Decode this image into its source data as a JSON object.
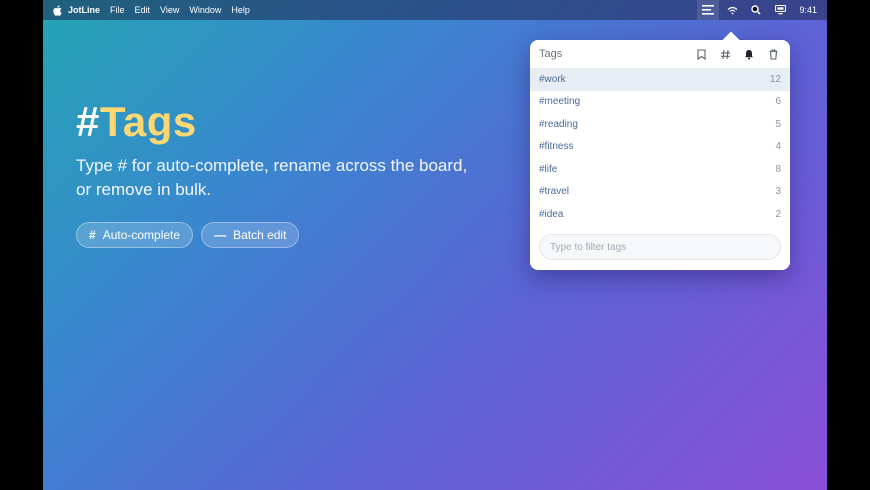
{
  "menubar": {
    "app_name": "JotLine",
    "menus": [
      "File",
      "Edit",
      "View",
      "Window",
      "Help"
    ],
    "clock": "9:41",
    "status_icons": [
      "tags-menu-icon",
      "wifi-icon",
      "search-icon",
      "control-center-icon"
    ]
  },
  "hero": {
    "title_prefix": "#",
    "title_word": "Tags",
    "description": "Type # for auto-complete, rename across the board, or remove in bulk.",
    "pills": [
      {
        "icon": "#",
        "label": "Auto-complete"
      },
      {
        "icon": "—",
        "label": "Batch edit"
      }
    ]
  },
  "popover": {
    "title": "Tags",
    "tools": [
      "bookmark-icon",
      "hash-icon",
      "bell-icon",
      "trash-icon"
    ],
    "tags": [
      {
        "name": "#work",
        "count": "12"
      },
      {
        "name": "#meeting",
        "count": "6"
      },
      {
        "name": "#reading",
        "count": "5"
      },
      {
        "name": "#fitness",
        "count": "4"
      },
      {
        "name": "#life",
        "count": "8"
      },
      {
        "name": "#travel",
        "count": "3"
      },
      {
        "name": "#idea",
        "count": "2"
      }
    ],
    "selected_index": 0,
    "filter_placeholder": "Type to filter tags"
  },
  "colors": {
    "accent_title": "#fbd873",
    "tag_text": "#4b6a94",
    "selected_row": "#e8edf5"
  }
}
